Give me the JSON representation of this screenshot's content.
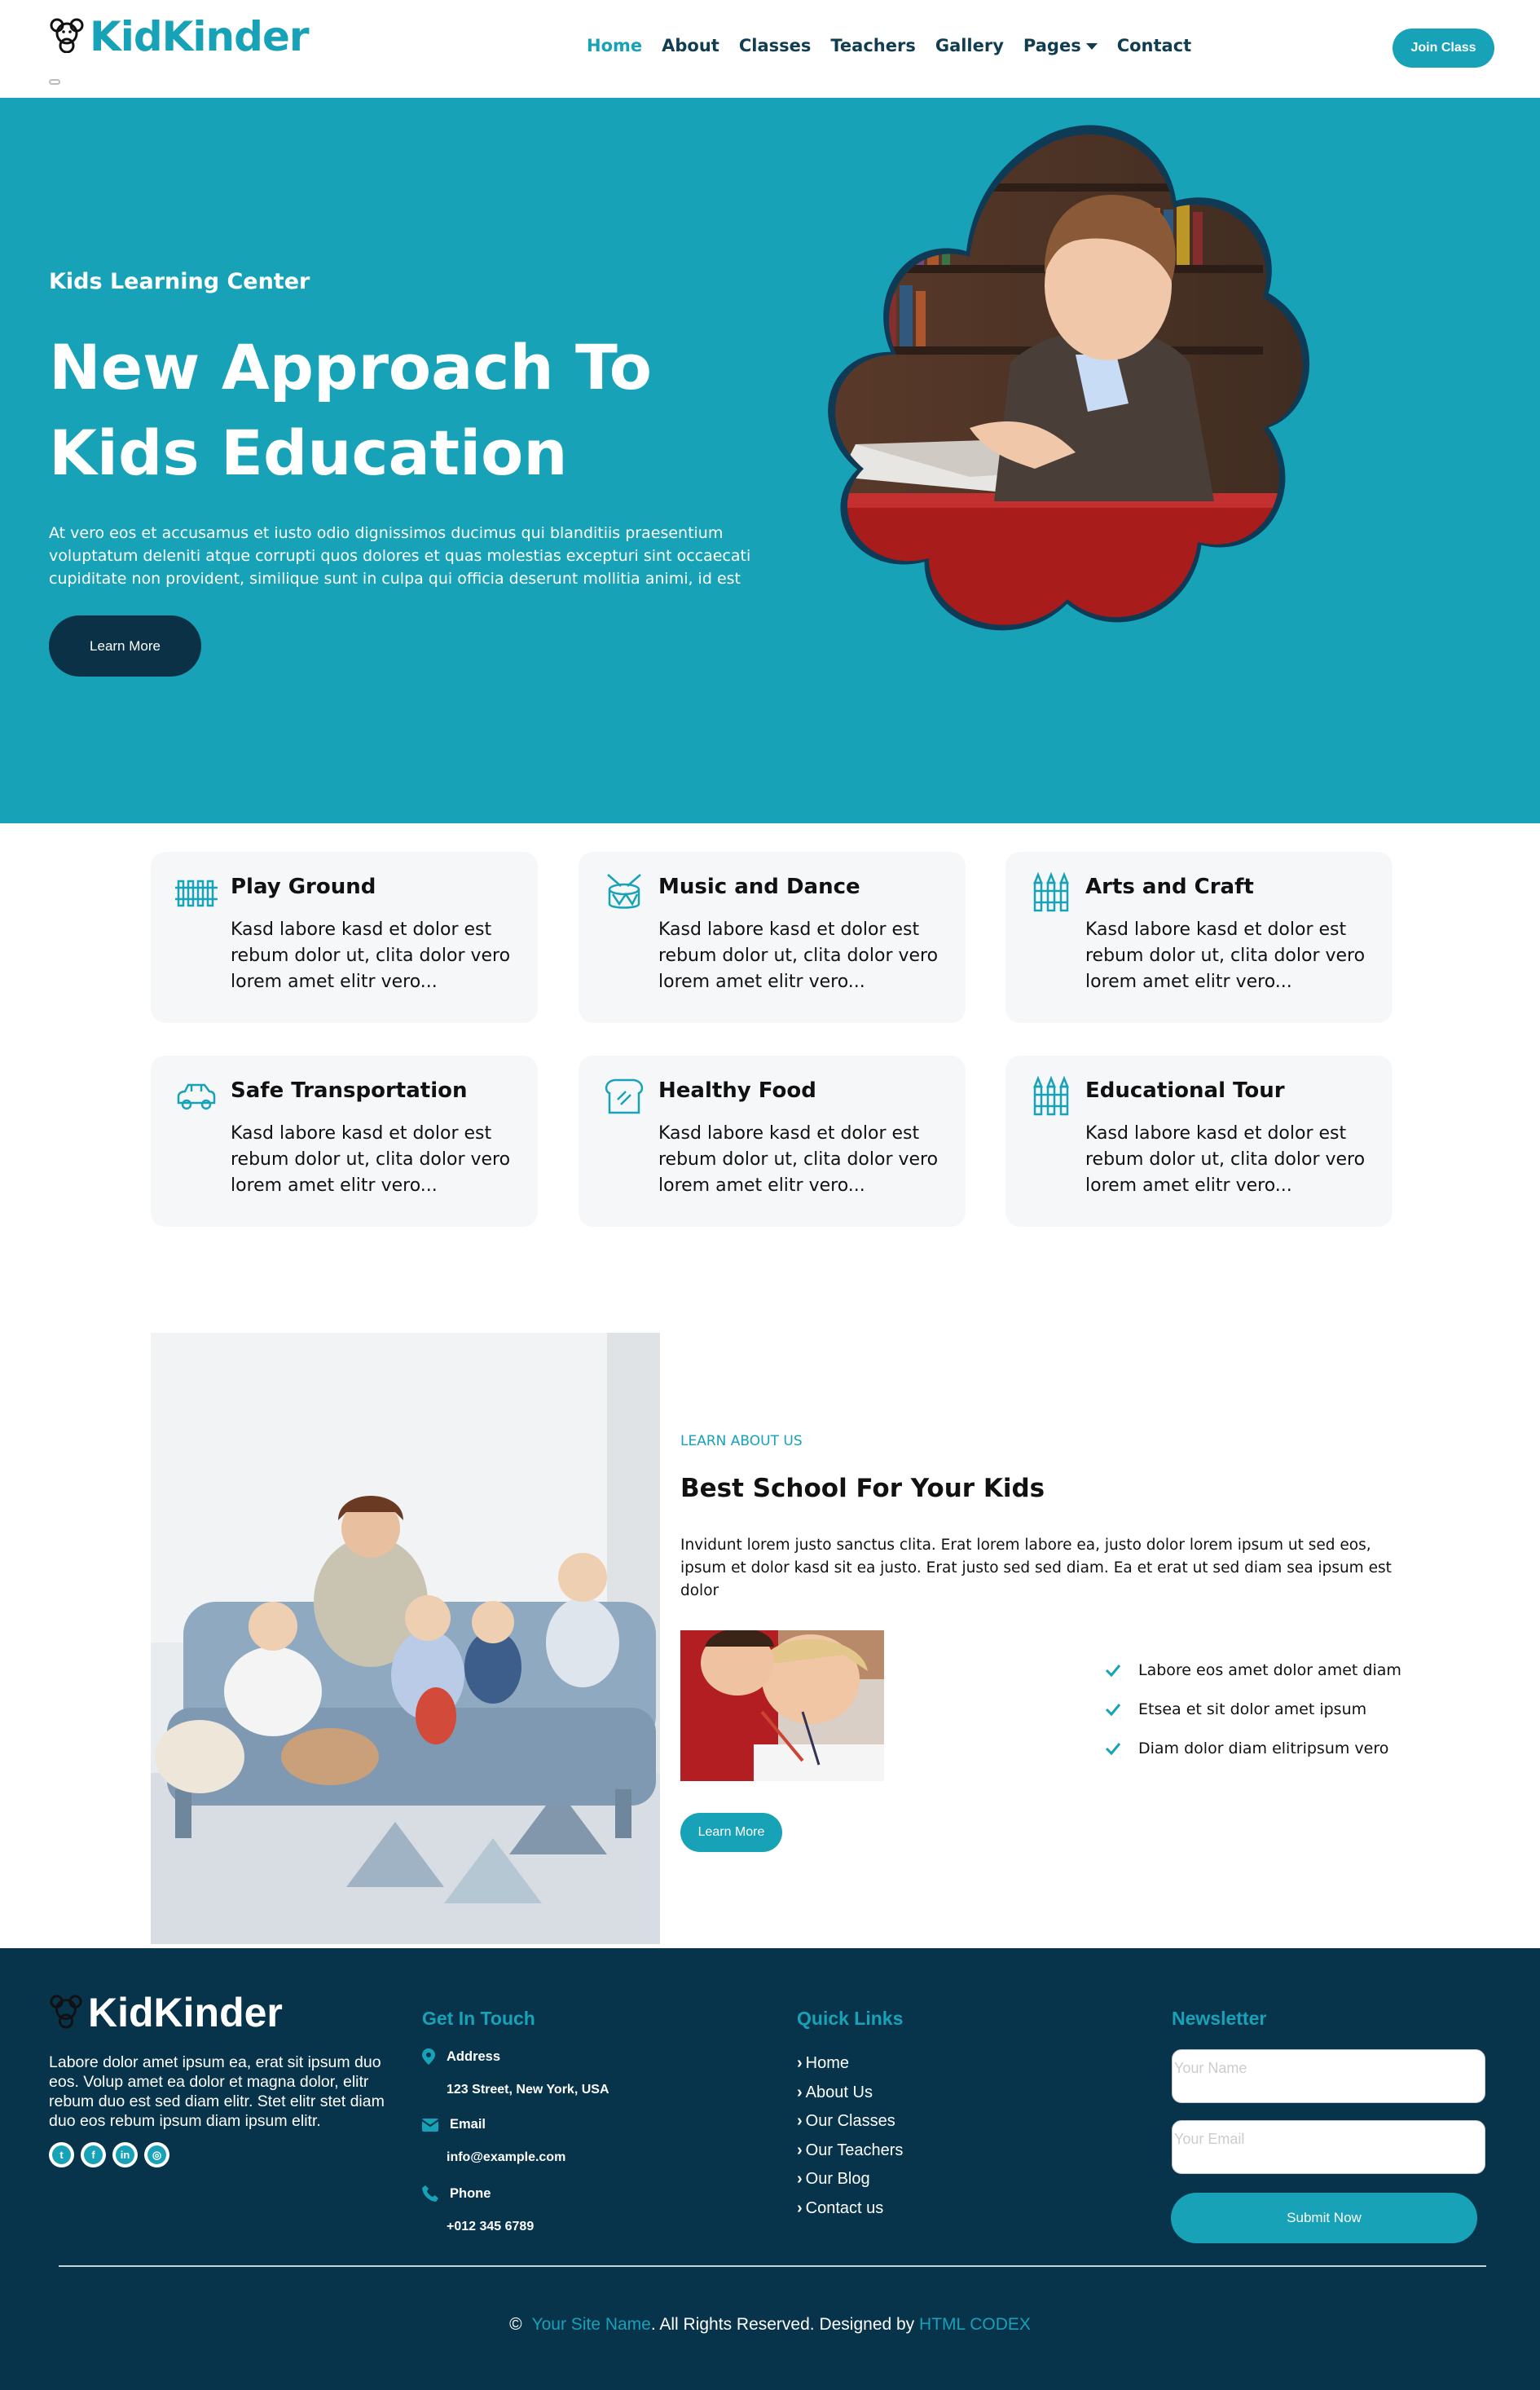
{
  "brand": {
    "name": "KidKinder",
    "icon": "teddy-bear-icon"
  },
  "nav": {
    "items": [
      {
        "label": "Home",
        "active": true
      },
      {
        "label": "About"
      },
      {
        "label": "Classes"
      },
      {
        "label": "Teachers"
      },
      {
        "label": "Gallery"
      },
      {
        "label": "Pages",
        "dropdown": true
      },
      {
        "label": "Contact"
      }
    ],
    "join_label": "Join Class"
  },
  "hero": {
    "subtitle": "Kids Learning Center",
    "title": "New Approach To Kids Education",
    "text": "At vero eos et accusamus et iusto odio dignissimos ducimus qui blanditiis praesentium voluptatum deleniti atque corrupti quos dolores et quas molestias excepturi sint occaecati cupiditate non provident, similique sunt in culpa qui officia deserunt mollitia animi, id est",
    "button": "Learn More"
  },
  "facilities": [
    {
      "icon": "fence-icon",
      "title": "Play Ground",
      "text": "Kasd labore kasd et dolor est rebum dolor ut, clita dolor vero lorem amet elitr vero..."
    },
    {
      "icon": "drum-icon",
      "title": "Music and Dance",
      "text": "Kasd labore kasd et dolor est rebum dolor ut, clita dolor vero lorem amet elitr vero..."
    },
    {
      "icon": "crayons-icon",
      "title": "Arts and Craft",
      "text": "Kasd labore kasd et dolor est rebum dolor ut, clita dolor vero lorem amet elitr vero..."
    },
    {
      "icon": "car-icon",
      "title": "Safe Transportation",
      "text": "Kasd labore kasd et dolor est rebum dolor ut, clita dolor vero lorem amet elitr vero..."
    },
    {
      "icon": "bread-icon",
      "title": "Healthy Food",
      "text": "Kasd labore kasd et dolor est rebum dolor ut, clita dolor vero lorem amet elitr vero..."
    },
    {
      "icon": "crayons-icon",
      "title": "Educational Tour",
      "text": "Kasd labore kasd et dolor est rebum dolor ut, clita dolor vero lorem amet elitr vero..."
    }
  ],
  "about": {
    "eyebrow": "LEARN ABOUT US",
    "title": "Best School For Your Kids",
    "text": "Invidunt lorem justo sanctus clita. Erat lorem labore ea, justo dolor lorem ipsum ut sed eos, ipsum et dolor kasd sit ea justo. Erat justo sed sed diam. Ea et erat ut sed diam sea ipsum est dolor",
    "checklist": [
      "Labore eos amet dolor amet diam",
      "Etsea et sit dolor amet ipsum",
      "Diam dolor diam elitripsum vero"
    ],
    "button": "Learn More"
  },
  "footer": {
    "brand": "KidKinder",
    "about": "Labore dolor amet ipsum ea, erat sit ipsum duo eos. Volup amet ea dolor et magna dolor, elitr rebum duo est sed diam elitr. Stet elitr stet diam duo eos rebum ipsum diam ipsum elitr.",
    "socials": [
      "twitter-icon",
      "facebook-icon",
      "linkedin-icon",
      "instagram-icon"
    ],
    "get_in_touch": {
      "heading": "Get In Touch",
      "address_label": "Address",
      "address": "123 Street, New York, USA",
      "email_label": "Email",
      "email": "info@example.com",
      "phone_label": "Phone",
      "phone": "+012 345 6789"
    },
    "quick_links": {
      "heading": "Quick Links",
      "items": [
        "Home",
        "About Us",
        "Our Classes",
        "Our Teachers",
        "Our Blog",
        "Contact us"
      ]
    },
    "newsletter": {
      "heading": "Newsletter",
      "name_placeholder": "Your Name",
      "email_placeholder": "Your Email",
      "submit": "Submit Now"
    },
    "copyright": {
      "symbol": "©",
      "site_name": "Your Site Name",
      "middle": ". All Rights Reserved. Designed by ",
      "designer": "HTML CODEX"
    }
  },
  "colors": {
    "primary": "#17a2b8",
    "dark": "#07334b",
    "card_bg": "#f5f7f9"
  }
}
